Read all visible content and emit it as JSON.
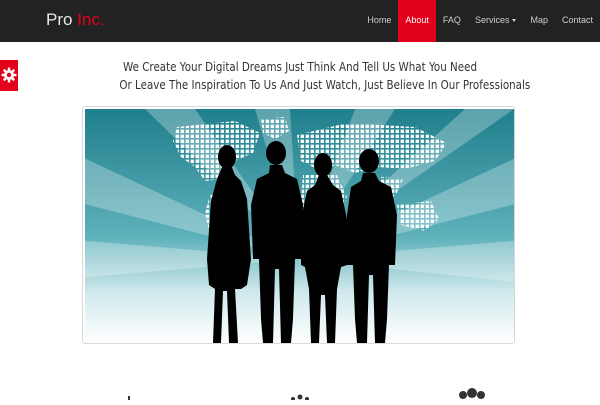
{
  "brand": {
    "main": "Pro",
    "accent": " Inc."
  },
  "nav": {
    "items": [
      {
        "label": "Home",
        "active": false
      },
      {
        "label": "About",
        "active": true
      },
      {
        "label": "FAQ",
        "active": false
      },
      {
        "label": "Services",
        "active": false,
        "dropdown": true
      },
      {
        "label": "Map",
        "active": false
      },
      {
        "label": "Contact",
        "active": false
      }
    ]
  },
  "headline": {
    "line1": "We Create Your Digital Dreams Just Think And Tell Us What You Need",
    "line2": "Or Leave The Inspiration To Us And Just Watch, Just Believe In Our Professionals"
  },
  "icons": {
    "settings": "gear-icon"
  },
  "colors": {
    "accent": "#e2001a",
    "navbar": "#222222",
    "hero_teal": "#3a9aa5"
  }
}
